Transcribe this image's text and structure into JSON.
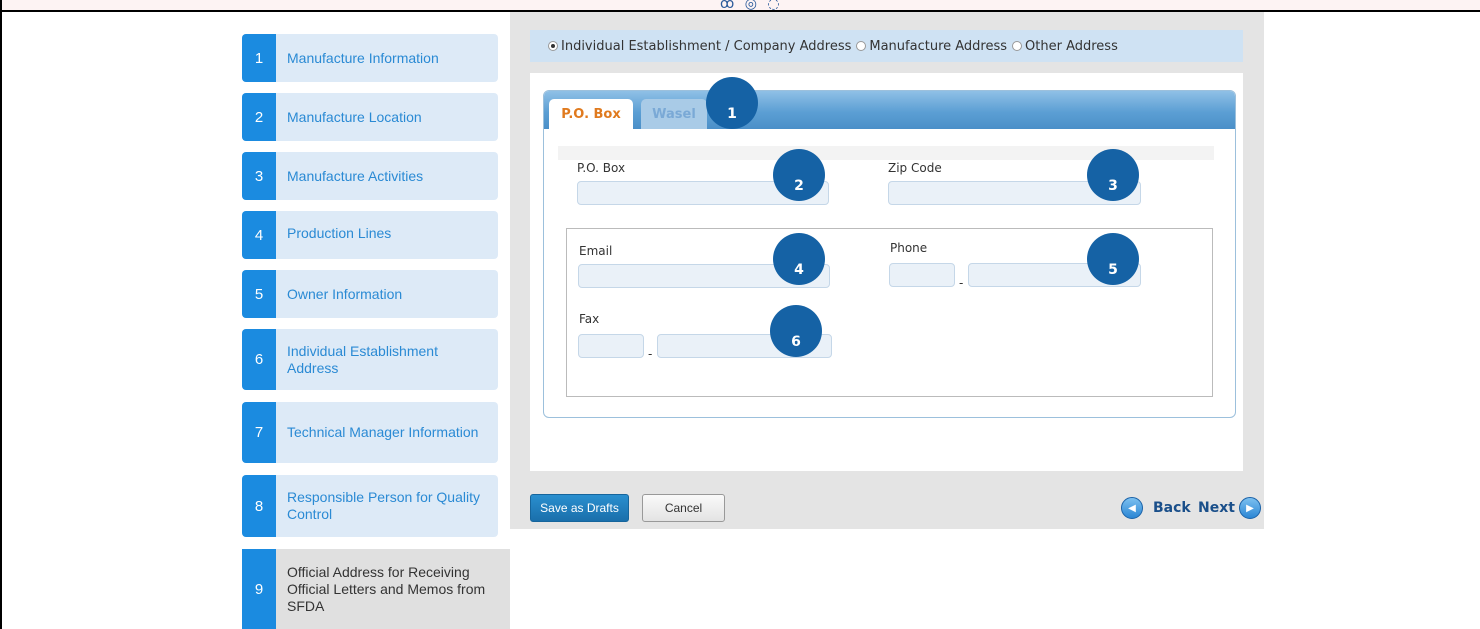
{
  "header": {
    "logo_text": "ꝏ ◎ ◌"
  },
  "sidebar": {
    "items": [
      {
        "num": "1",
        "label": "Manufacture Information"
      },
      {
        "num": "2",
        "label": "Manufacture Location"
      },
      {
        "num": "3",
        "label": "Manufacture Activities"
      },
      {
        "num": "4",
        "label": "Production Lines"
      },
      {
        "num": "5",
        "label": "Owner Information"
      },
      {
        "num": "6",
        "label": "Individual Establishment Address"
      },
      {
        "num": "7",
        "label": "Technical Manager Information"
      },
      {
        "num": "8",
        "label": "Responsible Person for Quality Control"
      },
      {
        "num": "9",
        "label": "Official Address for Receiving Official Letters and Memos from SFDA"
      }
    ],
    "active_item": "9"
  },
  "address_type": {
    "options": [
      "Individual Establishment / Company Address",
      "Manufacture Address",
      "Other Address"
    ],
    "selected": "Individual Establishment / Company Address"
  },
  "tabs": {
    "active": "P.O. Box",
    "inactive": "Wasel"
  },
  "form": {
    "po_box_label": "P.O. Box",
    "po_box_value": "",
    "zip_code_label": "Zip Code",
    "zip_code_value": "",
    "email_label": "Email",
    "email_value": "",
    "phone_label": "Phone",
    "phone_code_value": "",
    "phone_number_value": "",
    "fax_label": "Fax",
    "fax_code_value": "",
    "fax_number_value": "",
    "separator": "-"
  },
  "markers": [
    "1",
    "2",
    "3",
    "4",
    "5",
    "6"
  ],
  "footer": {
    "save_label": "Save as Drafts",
    "cancel_label": "Cancel",
    "back_label": "Back",
    "next_label": "Next"
  },
  "colors": {
    "accent": "#1b8be0",
    "tab_active_text": "#e07a1e",
    "marker": "#1562a5",
    "sidebar_bg": "#ddeaf7"
  }
}
